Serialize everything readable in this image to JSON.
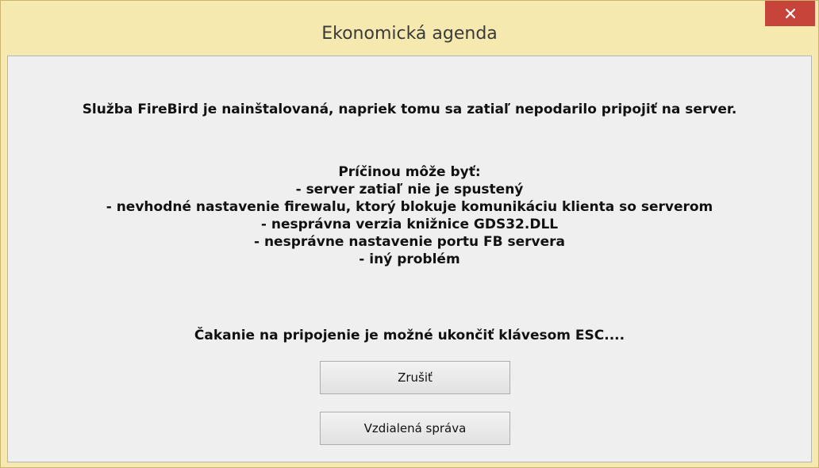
{
  "window": {
    "title": "Ekonomická agenda",
    "close_glyph": "✕"
  },
  "dialog": {
    "headline": "Služba FireBird je nainštalovaná, napriek tomu sa zatiaľ nepodarilo pripojiť na server.",
    "causes_heading": "Príčinou môže byť:",
    "causes": [
      "- server zatiaľ nie je spustený",
      "- nevhodné nastavenie firewalu, ktorý blokuje komunikáciu klienta so serverom",
      "- nesprávna verzia knižnice GDS32.DLL",
      "- nesprávne nastavenie portu FB servera",
      "- iný problém"
    ],
    "wait_message": "Čakanie na pripojenie je možné ukončiť klávesom ESC...."
  },
  "buttons": {
    "cancel_label": "Zrušiť",
    "remote_label": "Vzdialená správa"
  },
  "colors": {
    "frame": "#f6e9b0",
    "close_button": "#c7443b",
    "client_area": "#efefef"
  }
}
